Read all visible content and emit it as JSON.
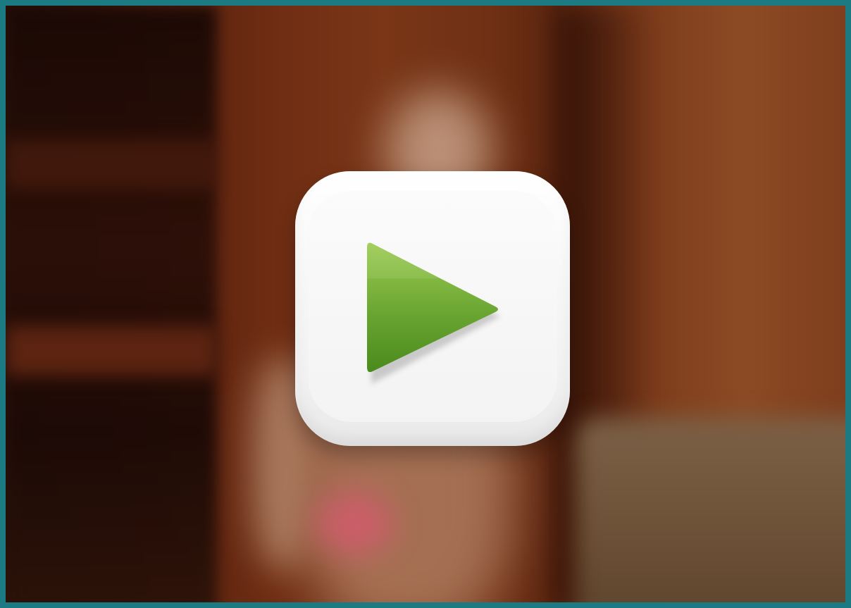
{
  "video_player": {
    "play_button": {
      "icon": "play-icon",
      "label": ""
    },
    "colors": {
      "frame_border": "#1c7a82",
      "button_face": "#f7f7f7",
      "play_green_top": "#93c64c",
      "play_green_bottom": "#4e8e1e"
    }
  }
}
